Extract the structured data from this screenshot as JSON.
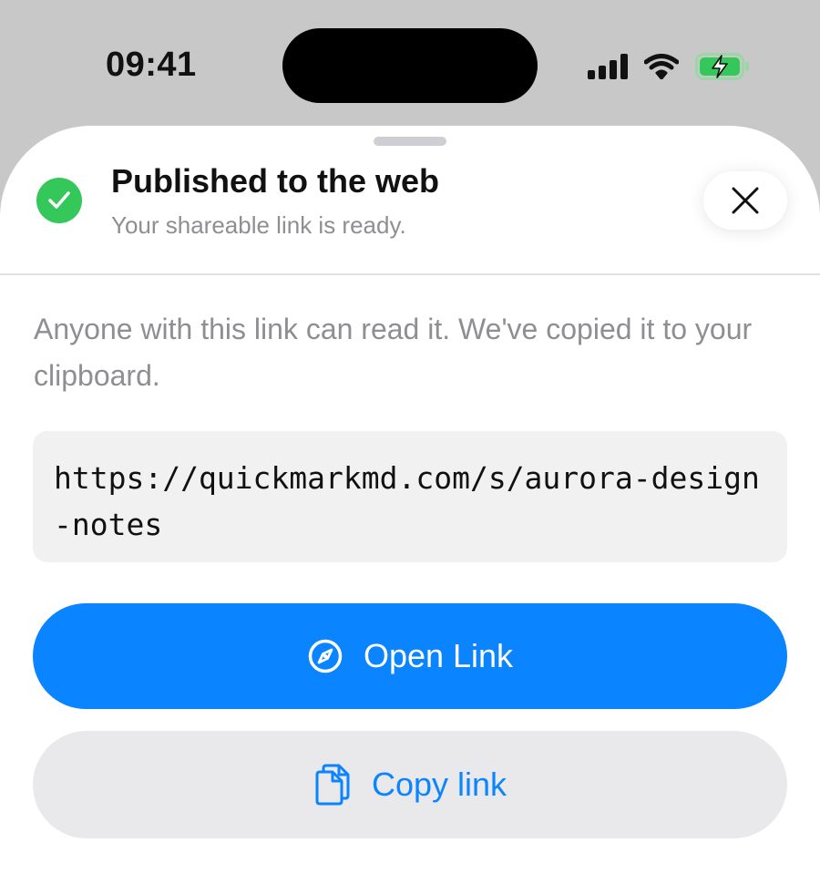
{
  "status_bar": {
    "time": "09:41",
    "icons": [
      "cellular-signal-icon",
      "wifi-icon",
      "battery-charging-icon"
    ],
    "battery_color": "#34c759"
  },
  "sheet": {
    "status_icon": "checkmark-circle-icon",
    "title": "Published to the web",
    "subtitle": "Your shareable link is ready.",
    "close_icon": "close-icon",
    "description": "Anyone with this link can read it. We've copied it to your clipboard.",
    "url": "https://quickmarkmd.com/s/aurora-design-notes",
    "open_button": {
      "icon": "compass-icon",
      "label": "Open Link"
    },
    "copy_button": {
      "icon": "copy-icon",
      "label": "Copy link"
    }
  },
  "colors": {
    "accent": "#0a84ff",
    "success": "#34c759",
    "secondary_text": "#8e8e93",
    "backdrop": "#c8c8c8"
  }
}
